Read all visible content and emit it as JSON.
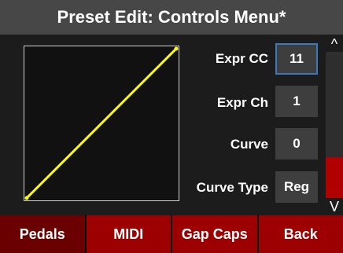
{
  "header": {
    "title": "Preset Edit: Controls Menu*"
  },
  "curve": {
    "line_color": "#ffff00"
  },
  "params": {
    "expr_cc": {
      "label": "Expr CC",
      "value": "11"
    },
    "expr_ch": {
      "label": "Expr Ch",
      "value": "1"
    },
    "curve": {
      "label": "Curve",
      "value": "0"
    },
    "curve_type": {
      "label": "Curve Type",
      "value": "Reg"
    }
  },
  "scrollbar": {
    "up_glyph": "^",
    "down_glyph": "V"
  },
  "footer": {
    "buttons": [
      {
        "label": "Pedals",
        "active": true
      },
      {
        "label": "MIDI",
        "active": false
      },
      {
        "label": "Gap Caps",
        "active": false
      },
      {
        "label": "Back",
        "active": false
      }
    ]
  },
  "colors": {
    "title_bar": "#474747",
    "selected_border": "#3d78b8",
    "nav_red": "#9c0000",
    "scroll_thumb": "#b10000"
  }
}
